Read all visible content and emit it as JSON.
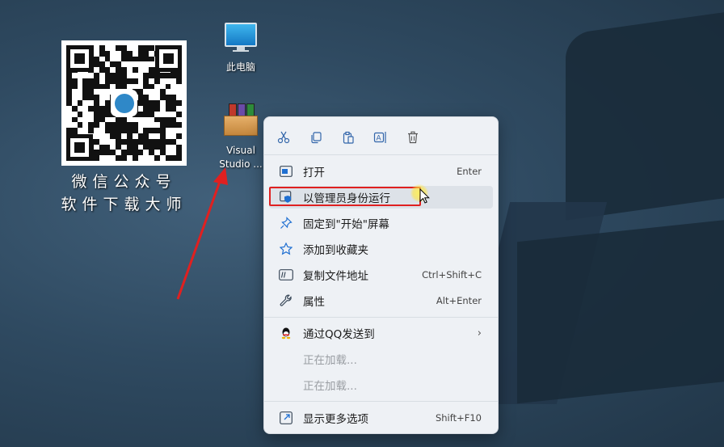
{
  "desktop": {
    "qr_caption_line1": "微信公众号",
    "qr_caption_line2": "软件下载大师",
    "icons": [
      {
        "label": "此电脑",
        "icon": "monitor-icon"
      },
      {
        "label_line1": "Visual",
        "label_line2": "Studio ...",
        "icon": "winrar-box-icon"
      }
    ]
  },
  "context_menu": {
    "toolbar": [
      "cut-icon",
      "copy-icon",
      "paste-icon",
      "rename-icon",
      "delete-icon"
    ],
    "items": [
      {
        "label": "打开",
        "shortcut": "Enter",
        "icon": "open-window-icon"
      },
      {
        "label": "以管理员身份运行",
        "shortcut": "",
        "icon": "shield-icon"
      },
      {
        "label": "固定到\"开始\"屏幕",
        "shortcut": "",
        "icon": "pin-icon"
      },
      {
        "label": "添加到收藏夹",
        "shortcut": "",
        "icon": "star-icon"
      },
      {
        "label": "复制文件地址",
        "shortcut": "Ctrl+Shift+C",
        "icon": "copy-path-icon"
      },
      {
        "label": "属性",
        "shortcut": "Alt+Enter",
        "icon": "wrench-icon"
      },
      {
        "label": "通过QQ发送到",
        "shortcut": "",
        "icon": "qq-icon"
      },
      {
        "label": "正在加载...",
        "shortcut": "",
        "icon": ""
      },
      {
        "label": "正在加载...",
        "shortcut": "",
        "icon": ""
      },
      {
        "label": "显示更多选项",
        "shortcut": "Shift+F10",
        "icon": "more-options-icon"
      }
    ]
  },
  "colors": {
    "highlight_border": "#e02020",
    "arrow": "#e02020",
    "accent": "#1f6fd1"
  }
}
